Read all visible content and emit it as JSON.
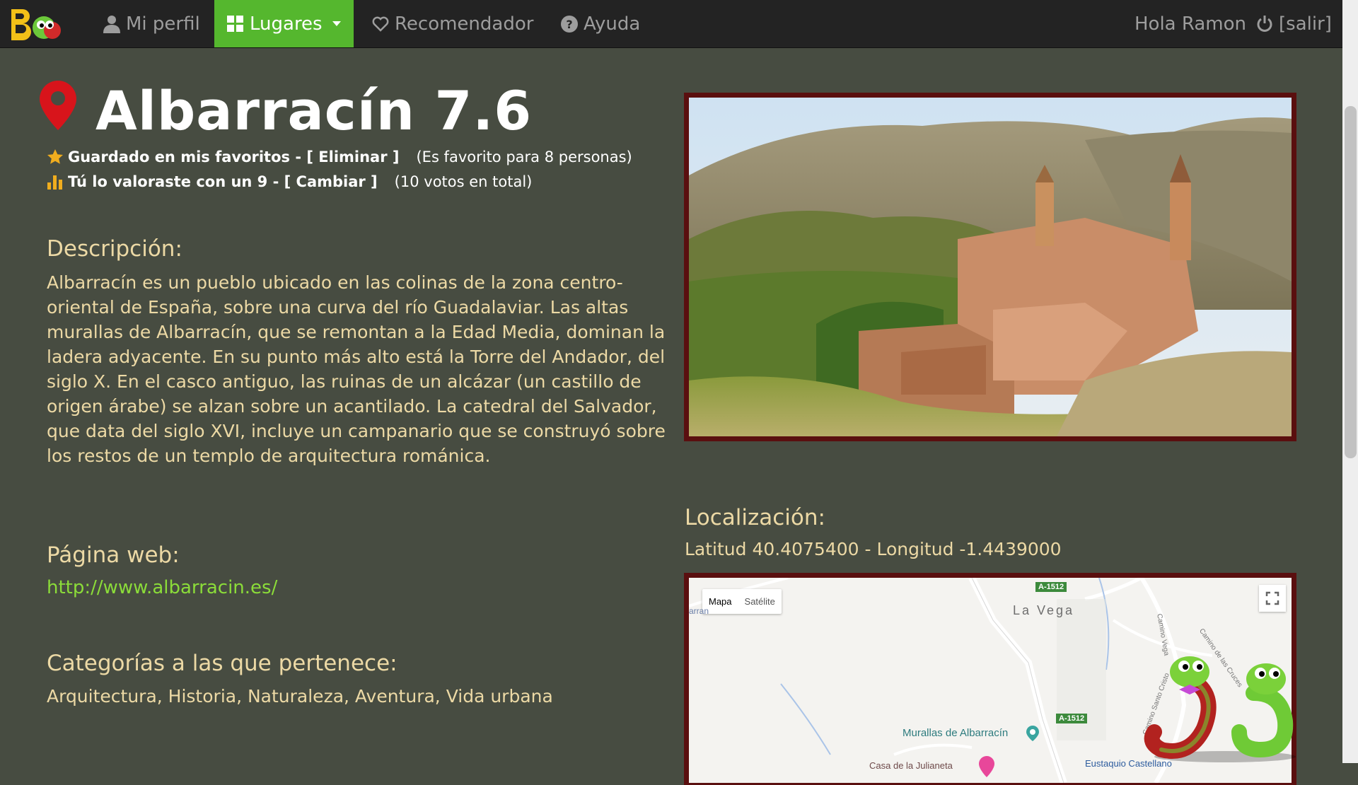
{
  "nav": {
    "profile": "Mi perfil",
    "places": "Lugares",
    "recommender": "Recomendador",
    "help": "Ayuda",
    "greeting": "Hola Ramon",
    "logout": "[salir]"
  },
  "place": {
    "title": "Albarracín 7.6",
    "favorite_label": "Guardado en mis favoritos - [ Eliminar ]",
    "favorite_note": "(Es favorito para 8 personas)",
    "rating_label": "Tú lo valoraste con un 9 - [ Cambiar ]",
    "rating_note": "(10 votos en total)",
    "description_heading": "Descripción:",
    "description": "Albarracín es un pueblo ubicado en las colinas de la zona centro-oriental de España, sobre una curva del río Guadalaviar. Las altas murallas de Albarracín, que se remontan a la Edad Media, dominan la ladera adyacente. En su punto más alto está la Torre del Andador, del siglo X. En el casco antiguo, las ruinas de un alcázar (un castillo de origen árabe) se alzan sobre un acantilado. La catedral del Salvador, que data del siglo XVI, incluye un campanario que se construyó sobre los restos de un templo de arquitectura románica.",
    "web_heading": "Página web:",
    "web_url": "http://www.albarracin.es/",
    "categories_heading": "Categorías a las que pertenece:",
    "categories": "Arquitectura, Historia, Naturaleza, Aventura, Vida urbana",
    "location_heading": "Localización:",
    "coordinates": "Latitud 40.4075400 - Longitud -1.4439000"
  },
  "map": {
    "map_button": "Mapa",
    "satellite_button": "Satélite",
    "labels": {
      "vega": "La Vega",
      "murallas": "Murallas de Albarracín",
      "casa": "Casa de la Julianeta",
      "eustaquio": "Eustaquio Castellano",
      "road1": "A-1512",
      "road2": "A-1512",
      "camino_vega": "Camino Vega",
      "camino_cruces": "Camino de las Cruces",
      "camino_santo": "Camino Santo Cristo",
      "partial": "arran"
    }
  },
  "colors": {
    "accent": "#55b72e",
    "link": "#8bdc39",
    "frame": "#5a0f0f",
    "background": "#474c41"
  }
}
